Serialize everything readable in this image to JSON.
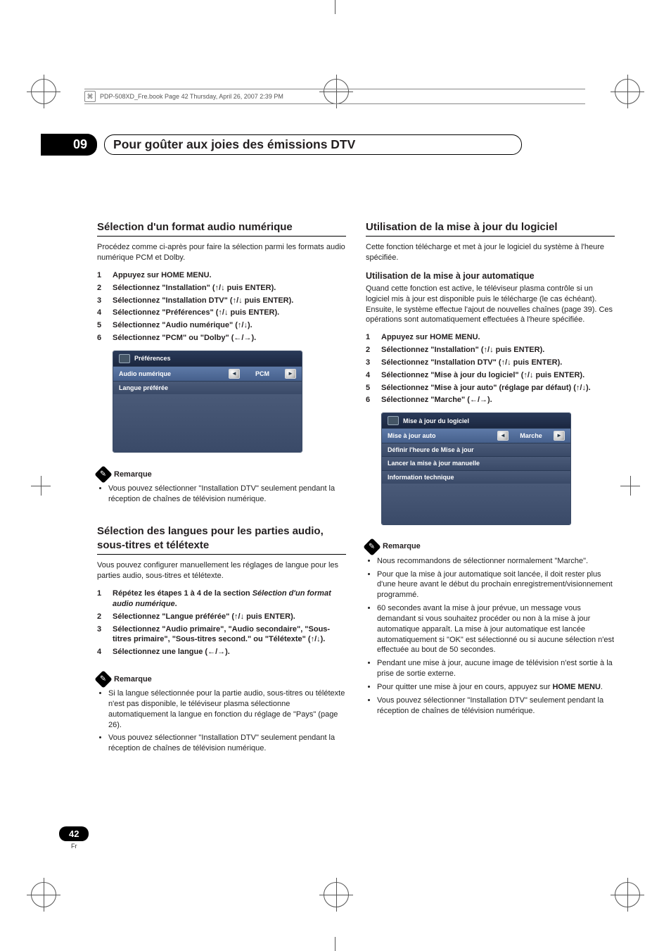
{
  "runhead": "PDP-508XD_Fre.book  Page 42  Thursday, April 26, 2007  2:39 PM",
  "chapter": {
    "num": "09",
    "title": "Pour goûter aux joies des émissions DTV"
  },
  "page": {
    "num": "42",
    "lang": "Fr"
  },
  "glyph": {
    "up": "↑",
    "down": "↓",
    "left": "←",
    "right": "→",
    "pen": "✎"
  },
  "left": {
    "sec1": {
      "title": "Sélection d'un format audio numérique",
      "intro": "Procédez comme ci-après pour faire la sélection parmi les formats audio numérique PCM et Dolby.",
      "steps": [
        "Appuyez sur HOME MENU.",
        "Sélectionnez \"Installation\" (↑/↓ puis ENTER).",
        "Sélectionnez \"Installation DTV\" (↑/↓ puis ENTER).",
        "Sélectionnez \"Préférences\" (↑/↓ puis ENTER).",
        "Sélectionnez \"Audio numérique\" (↑/↓).",
        "Sélectionnez \"PCM\" ou \"Dolby\" (←/→)."
      ],
      "osd": {
        "title": "Préférences",
        "row_sel": {
          "label": "Audio numérique",
          "value": "PCM"
        },
        "row2": "Langue préférée"
      },
      "note_label": "Remarque",
      "notes": [
        "Vous pouvez sélectionner \"Installation DTV\" seulement pendant la réception de chaînes de télévision numérique."
      ]
    },
    "sec2": {
      "title": "Sélection des langues pour les parties audio, sous-titres et télétexte",
      "intro": "Vous pouvez configurer manuellement les réglages de langue pour les parties audio, sous-titres et télétexte.",
      "steps": [
        {
          "n": "1",
          "t_a": "Répétez les étapes 1 à 4 de la section ",
          "t_i": "Sélection d'un format audio numérique",
          "t_b": "."
        },
        {
          "n": "2",
          "t": "Sélectionnez \"Langue préférée\" (↑/↓ puis ENTER)."
        },
        {
          "n": "3",
          "t": "Sélectionnez \"Audio primaire\", \"Audio secondaire\", \"Sous-titres primaire\", \"Sous-titres second.\" ou \"Télétexte\" (↑/↓)."
        },
        {
          "n": "4",
          "t": "Sélectionnez une langue (←/→)."
        }
      ],
      "note_label": "Remarque",
      "notes": [
        "Si la langue sélectionnée pour la partie audio, sous-titres ou télétexte n'est pas disponible, le téléviseur plasma sélectionne automatiquement la langue en fonction du réglage de \"Pays\" (page 26).",
        "Vous pouvez sélectionner \"Installation DTV\" seulement pendant la réception de chaînes de télévision numérique."
      ]
    }
  },
  "right": {
    "sec1": {
      "title": "Utilisation de la mise à jour du logiciel",
      "intro": "Cette fonction télécharge et met à jour le logiciel du système à l'heure spécifiée.",
      "sub": "Utilisation de la mise à jour automatique",
      "subintro": "Quand cette fonction est active, le téléviseur plasma contrôle si un logiciel mis à jour est disponible puis le télécharge (le cas échéant). Ensuite, le système effectue l'ajout de nouvelles chaînes (page 39). Ces opérations sont automatiquement effectuées à l'heure spécifiée.",
      "steps": [
        "Appuyez sur HOME MENU.",
        "Sélectionnez \"Installation\" (↑/↓ puis ENTER).",
        "Sélectionnez \"Installation DTV\" (↑/↓ puis ENTER).",
        "Sélectionnez \"Mise à jour du logiciel\" (↑/↓ puis ENTER).",
        "Sélectionnez \"Mise à jour auto\" (réglage par défaut) (↑/↓).",
        "Sélectionnez \"Marche\" (←/→)."
      ],
      "osd": {
        "title": "Mise à jour du logiciel",
        "row_sel": {
          "label": "Mise à jour auto",
          "value": "Marche"
        },
        "rows": [
          "Définir l'heure de Mise à jour",
          "Lancer la mise à jour manuelle",
          "Information technique"
        ]
      },
      "note_label": "Remarque",
      "notes_plain": [
        "Nous recommandons de sélectionner normalement \"Marche\".",
        "Pour que la mise à jour automatique soit lancée, il doit rester plus d'une heure avant le début du prochain enregistrement/visionnement programmé.",
        "60 secondes avant la mise à jour prévue, un message vous demandant si vous souhaitez procéder ou non à la mise à jour automatique apparaît. La mise à jour automatique est lancée automatiquement si \"OK\" est sélectionné ou si aucune sélection n'est effectuée au bout de 50 secondes.",
        "Pendant une mise à jour, aucune image de télévision n'est sortie à la prise de sortie externe."
      ],
      "note_bold_a": "Pour quitter une mise à jour en cours, appuyez sur ",
      "note_bold_b": "HOME MENU",
      "note_bold_c": ".",
      "notes_plain2": [
        "Vous pouvez sélectionner \"Installation DTV\" seulement pendant la réception de chaînes de télévision numérique."
      ]
    }
  }
}
